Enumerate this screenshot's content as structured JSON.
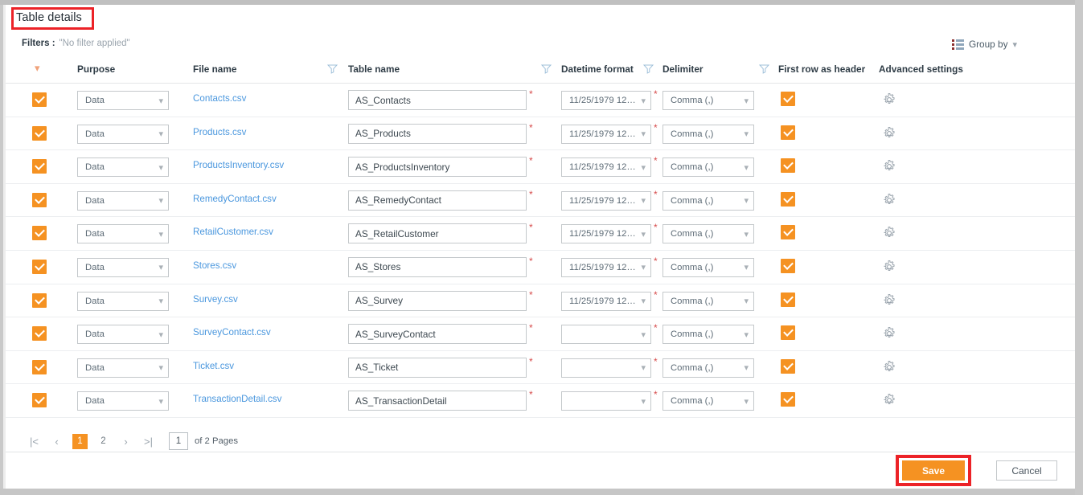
{
  "header": {
    "title": "Table details",
    "filters_label": "Filters :",
    "filters_value": "\"No filter applied\"",
    "group_by_label": "Group by",
    "group_by_chevron": "chevron-down"
  },
  "columns": {
    "purpose": "Purpose",
    "file_name": "File name",
    "table_name": "Table name",
    "datetime_format": "Datetime format",
    "delimiter": "Delimiter",
    "first_row_as_header": "First row as header",
    "advanced_settings": "Advanced settings"
  },
  "rows": [
    {
      "selected": true,
      "purpose": "Data",
      "file_name": "Contacts.csv",
      "table_name": "AS_Contacts",
      "datetime_format": "11/25/1979 12:0...",
      "delimiter": "Comma (,)",
      "first_row_as_header": true
    },
    {
      "selected": true,
      "purpose": "Data",
      "file_name": "Products.csv",
      "table_name": "AS_Products",
      "datetime_format": "11/25/1979 12:0...",
      "delimiter": "Comma (,)",
      "first_row_as_header": true
    },
    {
      "selected": true,
      "purpose": "Data",
      "file_name": "ProductsInventory.csv",
      "table_name": "AS_ProductsInventory",
      "datetime_format": "11/25/1979 12:0...",
      "delimiter": "Comma (,)",
      "first_row_as_header": true
    },
    {
      "selected": true,
      "purpose": "Data",
      "file_name": "RemedyContact.csv",
      "table_name": "AS_RemedyContact",
      "datetime_format": "11/25/1979 12:0...",
      "delimiter": "Comma (,)",
      "first_row_as_header": true
    },
    {
      "selected": true,
      "purpose": "Data",
      "file_name": "RetailCustomer.csv",
      "table_name": "AS_RetailCustomer",
      "datetime_format": "11/25/1979 12:0...",
      "delimiter": "Comma (,)",
      "first_row_as_header": true
    },
    {
      "selected": true,
      "purpose": "Data",
      "file_name": "Stores.csv",
      "table_name": "AS_Stores",
      "datetime_format": "11/25/1979 12:0...",
      "delimiter": "Comma (,)",
      "first_row_as_header": true
    },
    {
      "selected": true,
      "purpose": "Data",
      "file_name": "Survey.csv",
      "table_name": "AS_Survey",
      "datetime_format": "11/25/1979 12:0...",
      "delimiter": "Comma (,)",
      "first_row_as_header": true
    },
    {
      "selected": true,
      "purpose": "Data",
      "file_name": "SurveyContact.csv",
      "table_name": "AS_SurveyContact",
      "datetime_format": "",
      "delimiter": "Comma (,)",
      "first_row_as_header": true
    },
    {
      "selected": true,
      "purpose": "Data",
      "file_name": "Ticket.csv",
      "table_name": "AS_Ticket",
      "datetime_format": "",
      "delimiter": "Comma (,)",
      "first_row_as_header": true
    },
    {
      "selected": true,
      "purpose": "Data",
      "file_name": "TransactionDetail.csv",
      "table_name": "AS_TransactionDetail",
      "datetime_format": "",
      "delimiter": "Comma (,)",
      "first_row_as_header": true
    }
  ],
  "pagination": {
    "first_label": "|<",
    "prev_label": "‹",
    "pages": [
      "1",
      "2"
    ],
    "active_page": "1",
    "next_label": "›",
    "last_label": ">|",
    "page_input_value": "1",
    "of_pages_label": "of 2 Pages"
  },
  "footer": {
    "save_label": "Save",
    "cancel_label": "Cancel"
  },
  "colors": {
    "accent_orange": "#f59222",
    "link_blue": "#4a97de",
    "highlight_red": "#ec2227",
    "required_red": "#d64b4b"
  }
}
